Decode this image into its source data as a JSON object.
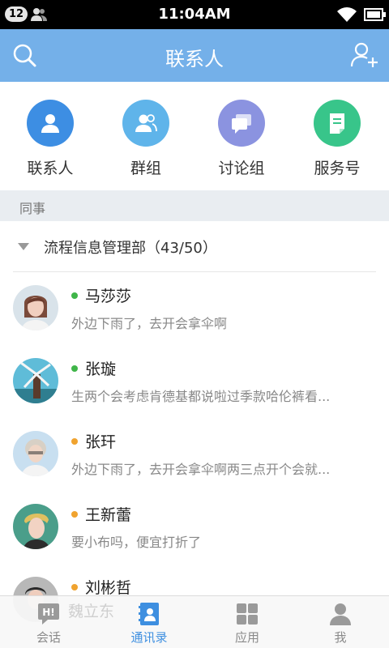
{
  "status_bar": {
    "badge": "12",
    "time": "11:04AM"
  },
  "header": {
    "title": "联系人"
  },
  "quick_actions": [
    {
      "label": "联系人",
      "color": "#3d8ee3",
      "icon": "person-icon"
    },
    {
      "label": "群组",
      "color": "#5fb4ea",
      "icon": "group-icon"
    },
    {
      "label": "讨论组",
      "color": "#8b93e0",
      "icon": "chat-bubbles-icon"
    },
    {
      "label": "服务号",
      "color": "#38c58a",
      "icon": "document-icon"
    }
  ],
  "section": {
    "label": "同事"
  },
  "group": {
    "label": "流程信息管理部（43/50）"
  },
  "contacts": [
    {
      "name": "马莎莎",
      "message": "外边下雨了，去开会拿伞啊",
      "status_color": "#3fb549"
    },
    {
      "name": "张璇",
      "message": "生两个会考虑肯德基都说啦过季款哈伦裤看...",
      "status_color": "#3fb549"
    },
    {
      "name": "张玕",
      "message": "外边下雨了，去开会拿伞啊两三点开个会就...",
      "status_color": "#f0a32f"
    },
    {
      "name": "王新蕾",
      "message": "要小布吗，便宜打折了",
      "status_color": "#f0a32f"
    },
    {
      "name": "刘彬哲",
      "message": "",
      "status_color": "#f0a32f"
    }
  ],
  "ghost_name": "魏立东",
  "tabs": [
    {
      "label": "会话",
      "icon": "chat-hi-icon",
      "active": false
    },
    {
      "label": "通讯录",
      "icon": "address-book-icon",
      "active": true
    },
    {
      "label": "应用",
      "icon": "apps-grid-icon",
      "active": false
    },
    {
      "label": "我",
      "icon": "profile-icon",
      "active": false
    }
  ],
  "colors": {
    "header": "#74b0e9",
    "accent": "#3e8fe0"
  }
}
